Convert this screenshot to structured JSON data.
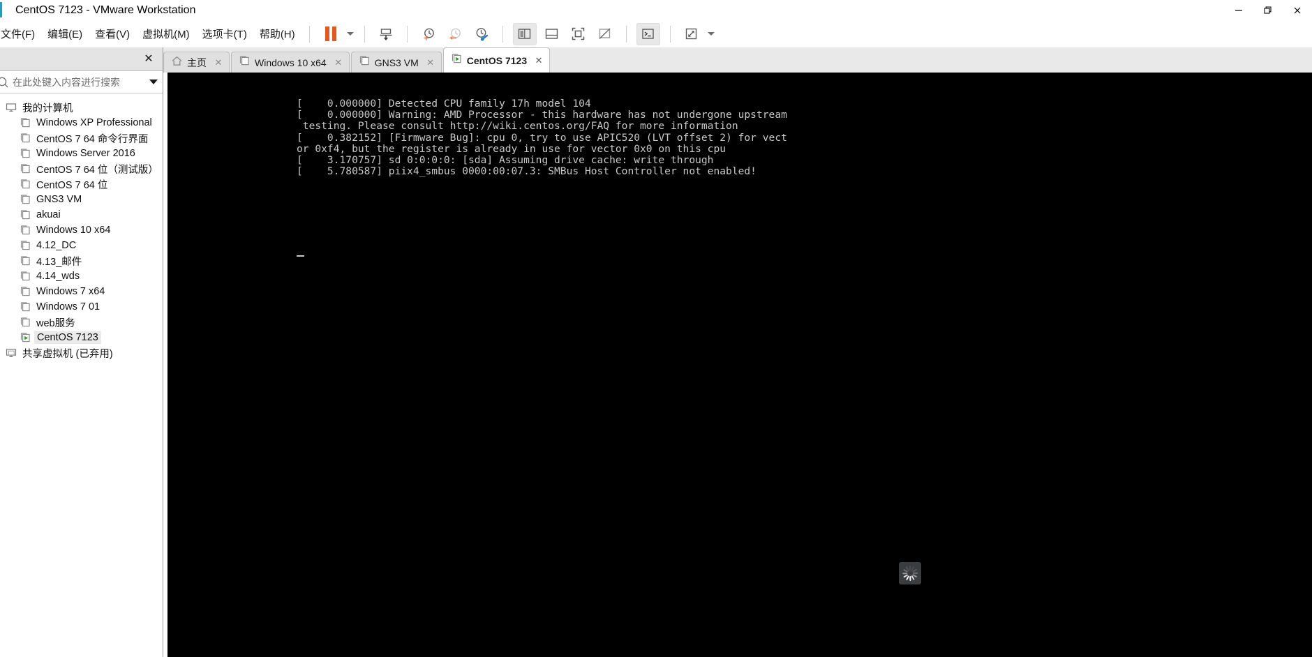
{
  "window": {
    "title": "CentOS 7123 - VMware Workstation",
    "accent_color": "#1aa0c8",
    "controls": {
      "minimize": "minimize-icon",
      "restore": "restore-icon",
      "close": "close-icon"
    }
  },
  "menu": {
    "items": [
      {
        "label": "文件(F)",
        "name": "menu-file"
      },
      {
        "label": "编辑(E)",
        "name": "menu-edit"
      },
      {
        "label": "查看(V)",
        "name": "menu-view"
      },
      {
        "label": "虚拟机(M)",
        "name": "menu-vm"
      },
      {
        "label": "选项卡(T)",
        "name": "menu-tabs"
      },
      {
        "label": "帮助(H)",
        "name": "menu-help"
      }
    ]
  },
  "toolbar": {
    "buttons": [
      {
        "name": "pause-vm-button",
        "icon": "pause-icon",
        "color": "#e8571e"
      },
      {
        "name": "power-dropdown-button",
        "icon": "chevron-down-icon"
      },
      {
        "name": "send-ctrl-alt-del-button",
        "icon": "transfer-down-icon"
      },
      {
        "name": "take-snapshot-button",
        "icon": "snapshot-add-icon"
      },
      {
        "name": "revert-snapshot-button",
        "icon": "snapshot-revert-icon"
      },
      {
        "name": "snapshot-manager-button",
        "icon": "snapshot-manage-icon"
      },
      {
        "name": "show-library-button",
        "icon": "panel-left-icon"
      },
      {
        "name": "show-thumbnail-bar-button",
        "icon": "panel-bottom-icon"
      },
      {
        "name": "full-screen-button",
        "icon": "fullscreen-icon"
      },
      {
        "name": "unity-mode-button",
        "icon": "unity-off-icon"
      },
      {
        "name": "console-view-button",
        "icon": "terminal-icon"
      },
      {
        "name": "stretch-guest-button",
        "icon": "stretch-icon"
      },
      {
        "name": "stretch-dropdown-button",
        "icon": "chevron-down-icon"
      }
    ]
  },
  "library": {
    "close_label": "✕",
    "search": {
      "placeholder": "在此处键入内容进行搜索",
      "value": "",
      "icon": "search-icon",
      "dropdown_icon": "chevron-down-icon"
    },
    "tree": [
      {
        "label": "我的计算机",
        "icon": "computer-icon",
        "indent": 0,
        "selected": false,
        "running": false
      },
      {
        "label": "Windows XP Professional",
        "icon": "vm-icon",
        "indent": 1,
        "selected": false,
        "running": false
      },
      {
        "label": "CentOS 7 64 命令行界面",
        "icon": "vm-icon",
        "indent": 1,
        "selected": false,
        "running": false
      },
      {
        "label": "Windows Server 2016",
        "icon": "vm-icon",
        "indent": 1,
        "selected": false,
        "running": false
      },
      {
        "label": "CentOS 7 64 位（测试版）",
        "icon": "vm-icon",
        "indent": 1,
        "selected": false,
        "running": false
      },
      {
        "label": "CentOS 7 64 位",
        "icon": "vm-icon",
        "indent": 1,
        "selected": false,
        "running": false
      },
      {
        "label": "GNS3 VM",
        "icon": "vm-icon",
        "indent": 1,
        "selected": false,
        "running": false
      },
      {
        "label": "akuai",
        "icon": "vm-icon",
        "indent": 1,
        "selected": false,
        "running": false
      },
      {
        "label": "Windows 10 x64",
        "icon": "vm-icon",
        "indent": 1,
        "selected": false,
        "running": false
      },
      {
        "label": "4.12_DC",
        "icon": "vm-icon",
        "indent": 1,
        "selected": false,
        "running": false
      },
      {
        "label": "4.13_邮件",
        "icon": "vm-icon",
        "indent": 1,
        "selected": false,
        "running": false
      },
      {
        "label": "4.14_wds",
        "icon": "vm-icon",
        "indent": 1,
        "selected": false,
        "running": false
      },
      {
        "label": "Windows 7 x64",
        "icon": "vm-icon",
        "indent": 1,
        "selected": false,
        "running": false
      },
      {
        "label": "Windows 7 01",
        "icon": "vm-icon",
        "indent": 1,
        "selected": false,
        "running": false
      },
      {
        "label": "web服务",
        "icon": "vm-icon",
        "indent": 1,
        "selected": false,
        "running": false
      },
      {
        "label": "CentOS 7123",
        "icon": "vm-running-icon",
        "indent": 1,
        "selected": true,
        "running": true
      },
      {
        "label": "共享虚拟机 (已弃用)",
        "icon": "shared-vms-icon",
        "indent": 0,
        "selected": false,
        "running": false
      }
    ]
  },
  "tabs": [
    {
      "label": "主页",
      "icon": "home-icon",
      "active": false,
      "close_label": "✕"
    },
    {
      "label": "Windows 10 x64",
      "icon": "vm-icon",
      "active": false,
      "close_label": "✕"
    },
    {
      "label": "GNS3 VM",
      "icon": "vm-icon",
      "active": false,
      "close_label": "✕"
    },
    {
      "label": "CentOS 7123",
      "icon": "vm-running-icon",
      "active": true,
      "close_label": "✕"
    }
  ],
  "console": {
    "background": "#000000",
    "text_color": "#c8c8c8",
    "lines": "[    0.000000] Detected CPU family 17h model 104\n[    0.000000] Warning: AMD Processor - this hardware has not undergone upstream\n testing. Please consult http://wiki.centos.org/FAQ for more information\n[    0.382152] [Firmware Bug]: cpu 0, try to use APIC520 (LVT offset 2) for vect\nor 0xf4, but the register is already in use for vector 0x0 on this cpu\n[    3.170757] sd 0:0:0:0: [sda] Assuming drive cache: write through\n[    5.780587] piix4_smbus 0000:00:07.3: SMBus Host Controller not enabled!",
    "cursor": "_",
    "spinner": "busy-spinner-icon"
  }
}
